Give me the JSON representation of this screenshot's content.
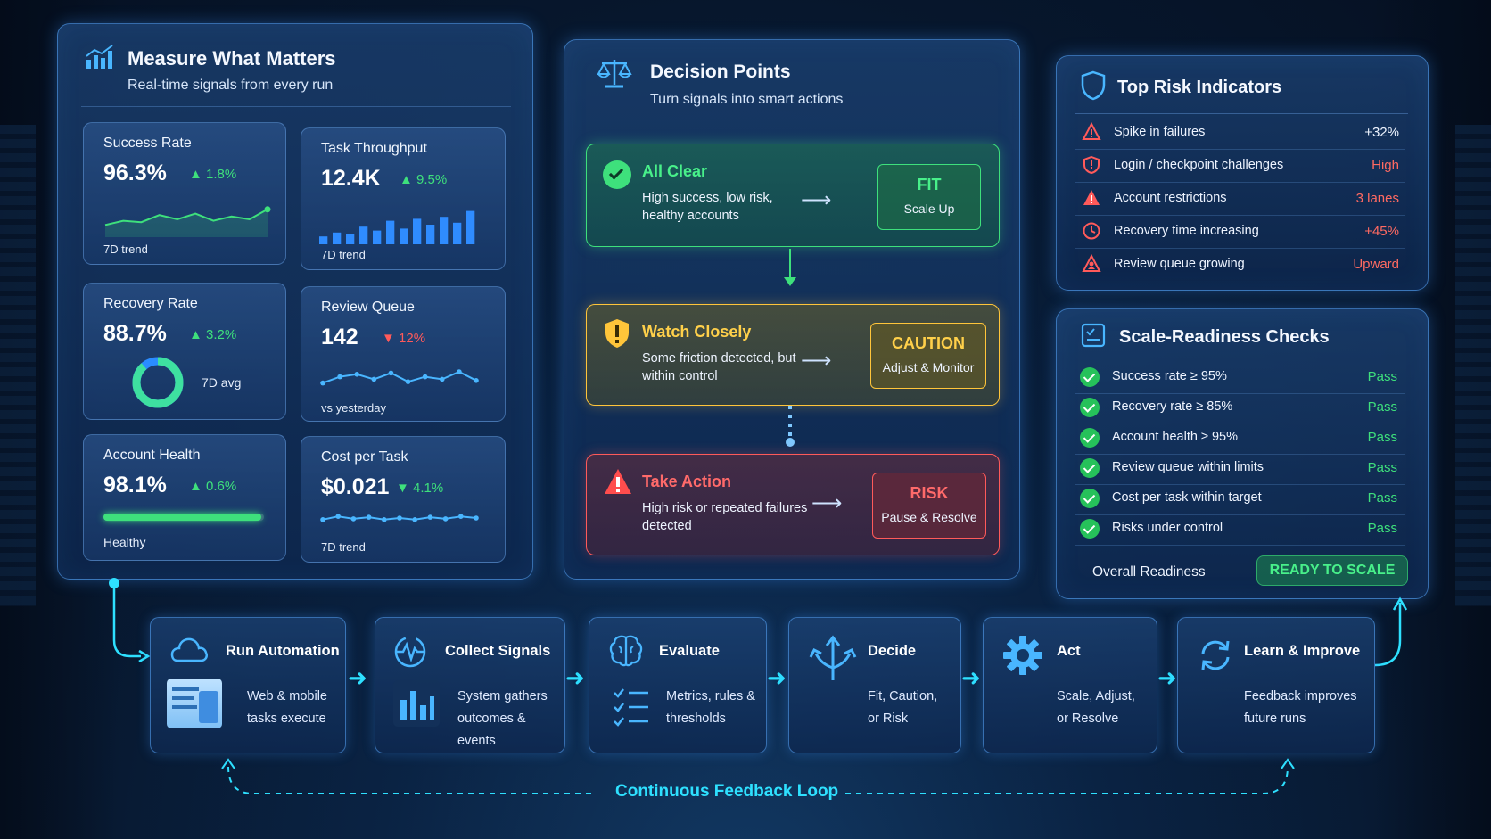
{
  "colors": {
    "accent": "#3aa6ff",
    "up": "#3ee07c",
    "down": "#ff5a5a",
    "cyan": "#2ee0ff",
    "caution": "#ffc53a"
  },
  "measure": {
    "title": "Measure What Matters",
    "subtitle": "Real-time signals from every run",
    "cards": [
      {
        "label": "Success Rate",
        "value": "96.3%",
        "delta": "▲ 1.8%",
        "foot": "7D trend"
      },
      {
        "label": "Task Throughput",
        "value": "12.4K",
        "delta": "▲ 9.5%",
        "foot": "7D trend"
      },
      {
        "label": "Recovery Rate",
        "value": "88.7%",
        "delta": "▲ 3.2%",
        "foot": "7D avg"
      },
      {
        "label": "Review Queue",
        "value": "142",
        "delta": "▼ 12%",
        "foot": "vs yesterday"
      },
      {
        "label": "Account Health",
        "value": "98.1%",
        "delta": "▲ 0.6%",
        "foot": "Healthy"
      },
      {
        "label": "Cost per Task",
        "value": "$0.021",
        "delta": "▼ 4.1%",
        "foot": "7D trend"
      }
    ]
  },
  "decision": {
    "title": "Decision Points",
    "subtitle": "Turn signals into smart actions",
    "items": [
      {
        "title": "All Clear",
        "desc": "High success, low risk, healthy accounts",
        "badge": "FIT",
        "action": "Scale Up"
      },
      {
        "title": "Watch Closely",
        "desc": "Some friction detected, but within control",
        "badge": "CAUTION",
        "action": "Adjust & Monitor"
      },
      {
        "title": "Take Action",
        "desc": "High risk or repeated failures detected",
        "badge": "RISK",
        "action": "Pause & Resolve"
      }
    ]
  },
  "risks": {
    "title": "Top Risk Indicators",
    "items": [
      {
        "label": "Spike in failures",
        "value": "+32%",
        "icon": "warning-icon"
      },
      {
        "label": "Login / checkpoint challenges",
        "value": "High",
        "icon": "shield-alert-icon"
      },
      {
        "label": "Account restrictions",
        "value": "3 lanes",
        "icon": "restriction-icon"
      },
      {
        "label": "Recovery time increasing",
        "value": "+45%",
        "icon": "clock-icon"
      },
      {
        "label": "Review queue growing",
        "value": "Upward",
        "icon": "user-alert-icon"
      }
    ]
  },
  "checks": {
    "title": "Scale-Readiness Checks",
    "items": [
      {
        "label": "Success rate ≥ 95%",
        "value": "Pass"
      },
      {
        "label": "Recovery rate  ≥ 85%",
        "value": "Pass"
      },
      {
        "label": "Account health ≥ 95%",
        "value": "Pass"
      },
      {
        "label": "Review queue within limits",
        "value": "Pass"
      },
      {
        "label": "Cost per task within target",
        "value": "Pass"
      },
      {
        "label": "Risks under control",
        "value": "Pass"
      }
    ],
    "overall_label": "Overall Readiness",
    "overall_value": "READY TO SCALE"
  },
  "flow": {
    "loop_label": "Continuous Feedback Loop",
    "steps": [
      {
        "title": "Run Automation",
        "desc": "Web & mobile tasks execute",
        "icon": "cloud-icon"
      },
      {
        "title": "Collect Signals",
        "desc": "System gathers outcomes & events",
        "icon": "pulse-icon"
      },
      {
        "title": "Evaluate",
        "desc": "Metrics, rules & thresholds",
        "icon": "brain-icon"
      },
      {
        "title": "Decide",
        "desc": "Fit, Caution, or Risk",
        "icon": "split-arrows-icon"
      },
      {
        "title": "Act",
        "desc": "Scale, Adjust, or Resolve",
        "icon": "gear-icon"
      },
      {
        "title": "Learn & Improve",
        "desc": "Feedback improves future runs",
        "icon": "refresh-icon"
      }
    ]
  },
  "trend_data": {
    "success": [
      0.3,
      0.45,
      0.4,
      0.65,
      0.5,
      0.7,
      0.45,
      0.6,
      0.5,
      0.85
    ],
    "throughput": [
      0.2,
      0.3,
      0.25,
      0.45,
      0.35,
      0.6,
      0.4,
      0.65,
      0.5,
      0.7,
      0.55,
      0.85
    ],
    "queue": [
      0.3,
      0.55,
      0.65,
      0.45,
      0.7,
      0.35,
      0.55,
      0.45,
      0.75,
      0.4
    ],
    "cost": [
      0.4,
      0.6,
      0.45,
      0.55,
      0.4,
      0.5,
      0.4,
      0.55,
      0.45,
      0.6,
      0.5
    ],
    "recovery_ring": 0.887,
    "health_bar": 0.981
  }
}
